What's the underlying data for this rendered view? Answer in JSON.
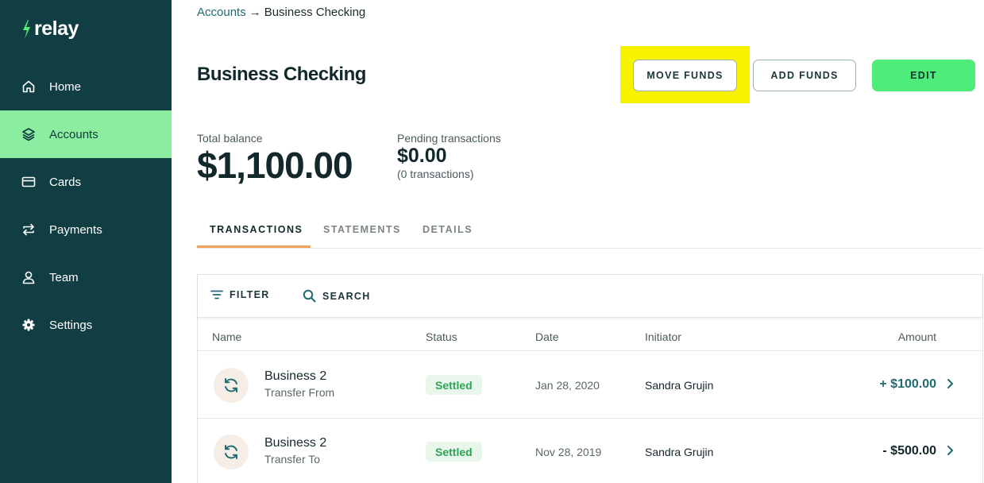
{
  "brand": {
    "name": "relay",
    "bolt_color": "#4eec78"
  },
  "sidebar": {
    "items": [
      {
        "label": "Home",
        "icon": "home-icon",
        "active": false
      },
      {
        "label": "Accounts",
        "icon": "layers-icon",
        "active": true
      },
      {
        "label": "Cards",
        "icon": "card-icon",
        "active": false
      },
      {
        "label": "Payments",
        "icon": "transfer-icon",
        "active": false
      },
      {
        "label": "Team",
        "icon": "person-icon",
        "active": false
      },
      {
        "label": "Settings",
        "icon": "gear-icon",
        "active": false
      }
    ]
  },
  "breadcrumb": {
    "parent": "Accounts",
    "arrow": "→",
    "current": "Business Checking"
  },
  "header": {
    "title": "Business Checking",
    "move_funds": "MOVE FUNDS",
    "add_funds": "ADD FUNDS",
    "edit": "EDIT"
  },
  "balance": {
    "total_label": "Total balance",
    "total_value": "$1,100.00",
    "pending_label": "Pending transactions",
    "pending_value": "$0.00",
    "pending_count": "(0 transactions)"
  },
  "tabs": [
    {
      "label": "TRANSACTIONS",
      "active": true
    },
    {
      "label": "STATEMENTS",
      "active": false
    },
    {
      "label": "DETAILS",
      "active": false
    }
  ],
  "toolbar": {
    "filter": "FILTER",
    "search": "SEARCH"
  },
  "table": {
    "columns": [
      "Name",
      "Status",
      "Date",
      "Initiator",
      "Amount"
    ],
    "rows": [
      {
        "name": "Business 2",
        "sub": "Transfer From",
        "status": "Settled",
        "date": "Jan 28, 2020",
        "initiator": "Sandra Grujin",
        "amount": "+ $100.00"
      },
      {
        "name": "Business 2",
        "sub": "Transfer To",
        "status": "Settled",
        "date": "Nov 28, 2019",
        "initiator": "Sandra Grujin",
        "amount": "- $500.00"
      }
    ]
  },
  "colors": {
    "sidebar": "#113e42",
    "active_nav": "#8aed9f",
    "edit_button": "#4eec78",
    "highlight": "#f7f300",
    "tab_underline": "#f0a35a"
  }
}
